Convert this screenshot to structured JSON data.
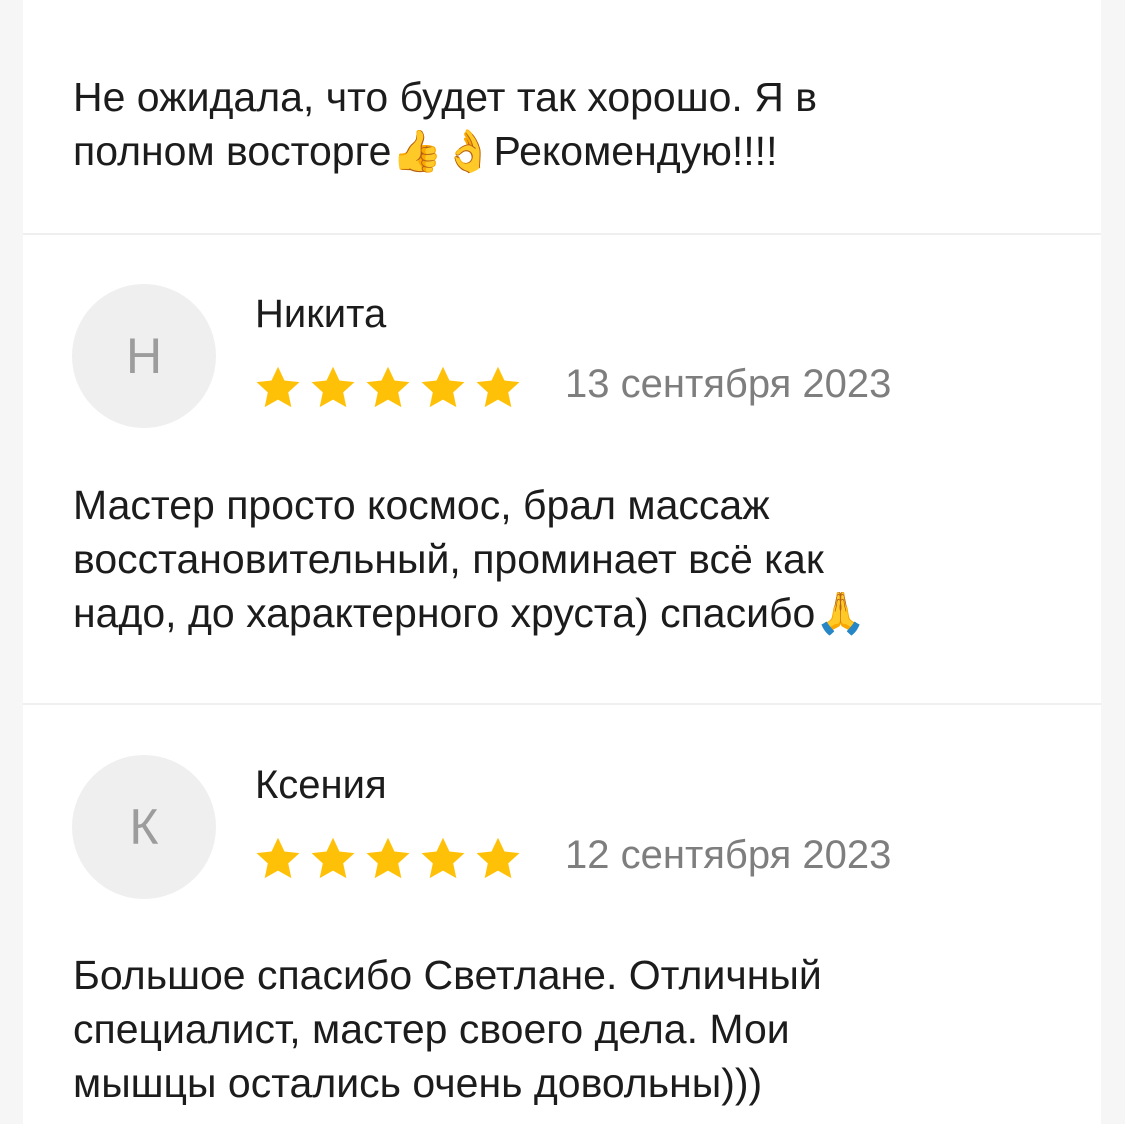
{
  "colors": {
    "star": "#FFC107",
    "avatar_bg": "#EFEFEF",
    "text": "#1C1C1C",
    "muted": "#7E7E7E"
  },
  "reviews": [
    {
      "text": "Не ожидала, что будет так хорошо. Я в\nполном восторге👍👌Рекомендую!!!!"
    },
    {
      "avatar_letter": "Н",
      "name": "Никита",
      "rating": 5,
      "date": "13 сентября 2023",
      "text": "Мастер просто космос, брал массаж\nвосстановительный, проминает всё как\nнадо, до характерного хруста) спасибо🙏"
    },
    {
      "avatar_letter": "К",
      "name": "Ксения",
      "rating": 5,
      "date": "12 сентября 2023",
      "text": "Большое спасибо Светлане. Отличный\nспециалист, мастер своего дела. Мои\nмышцы остались очень довольны)))"
    }
  ]
}
